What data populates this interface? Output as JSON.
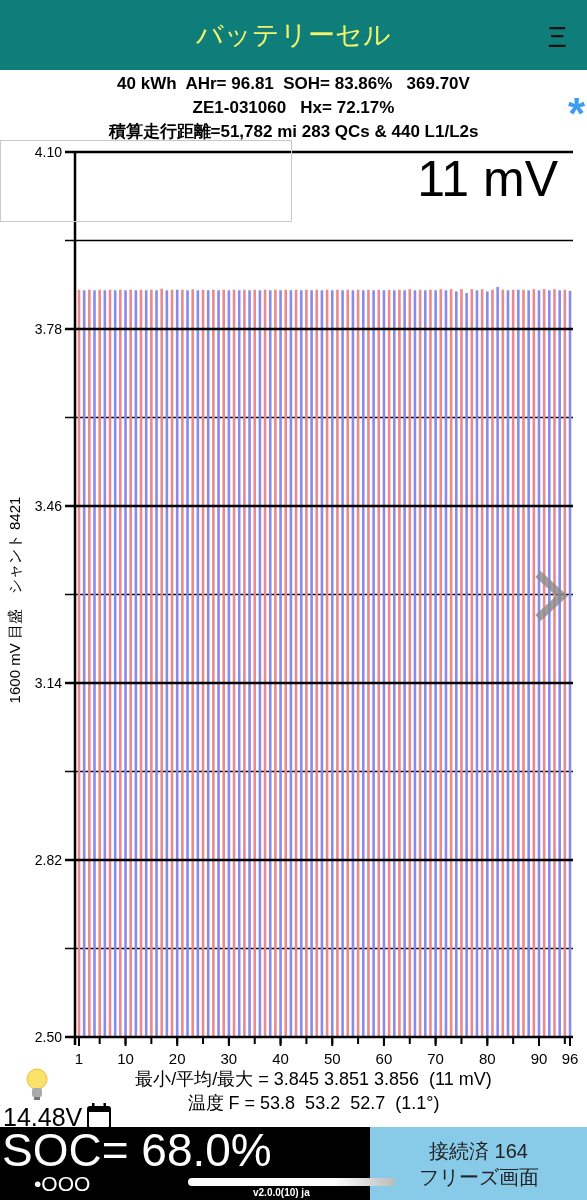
{
  "header": {
    "title": "バッテリーセル",
    "menu": "Ξ"
  },
  "info": {
    "lines": [
      "40 kWh  AHr= 96.81  SOH= 83.86%   369.70V",
      "ZE1-031060   Hx= 72.17%",
      "積算走行距離=51,782 mi 283 QCs & 440 L1/L2s"
    ],
    "asterisk": "*"
  },
  "cell_chart": {
    "chart_data": {
      "type": "bar",
      "ylabel": "1600 mV 目盛　シャント 8421",
      "ylim": [
        2.5,
        4.1
      ],
      "yticks": [
        {
          "value": 2.5,
          "label": "2.50"
        },
        {
          "value": 2.82,
          "label": "2.82"
        },
        {
          "value": 3.14,
          "label": "3.14"
        },
        {
          "value": 3.46,
          "label": "3.46"
        },
        {
          "value": 3.78,
          "label": "3.78"
        },
        {
          "value": 4.1,
          "label": "4.10"
        }
      ],
      "x": [
        1,
        2,
        3,
        4,
        5,
        6,
        7,
        8,
        9,
        10,
        11,
        12,
        13,
        14,
        15,
        16,
        17,
        18,
        19,
        20,
        21,
        22,
        23,
        24,
        25,
        26,
        27,
        28,
        29,
        30,
        31,
        32,
        33,
        34,
        35,
        36,
        37,
        38,
        39,
        40,
        41,
        42,
        43,
        44,
        45,
        46,
        47,
        48,
        49,
        50,
        51,
        52,
        53,
        54,
        55,
        56,
        57,
        58,
        59,
        60,
        61,
        62,
        63,
        64,
        65,
        66,
        67,
        68,
        69,
        70,
        71,
        72,
        73,
        74,
        75,
        76,
        77,
        78,
        79,
        80,
        81,
        82,
        83,
        84,
        85,
        86,
        87,
        88,
        89,
        90,
        91,
        92,
        93,
        94,
        95,
        96
      ],
      "xlim": [
        1,
        96
      ],
      "xticks": [
        1,
        10,
        20,
        30,
        40,
        50,
        60,
        70,
        80,
        90,
        96
      ],
      "grid": true,
      "annotations": [
        {
          "text": "11 mV"
        }
      ],
      "series": [
        {
          "color": "#e88a8f",
          "values": [
            3.851,
            null,
            3.851,
            null,
            3.851,
            null,
            3.851,
            null,
            3.851,
            null,
            3.851,
            null,
            3.851,
            null,
            3.851,
            null,
            3.853,
            null,
            3.851,
            null,
            3.851,
            null,
            3.852,
            null,
            3.851,
            null,
            3.851,
            null,
            3.851,
            null,
            3.851,
            null,
            3.851,
            null,
            3.851,
            null,
            3.851,
            null,
            3.851,
            null,
            3.851,
            null,
            3.851,
            null,
            3.851,
            null,
            3.851,
            null,
            3.851,
            null,
            3.851,
            null,
            3.851,
            null,
            3.851,
            null,
            3.851,
            null,
            3.851,
            null,
            3.851,
            null,
            3.851,
            null,
            3.852,
            null,
            3.851,
            null,
            3.851,
            null,
            3.852,
            null,
            3.852,
            null,
            3.852,
            null,
            3.852,
            null,
            3.852,
            null,
            3.851,
            null,
            3.851,
            null,
            3.851,
            null,
            3.851,
            null,
            3.852,
            null,
            3.852,
            null,
            3.852,
            null,
            3.851,
            null
          ]
        },
        {
          "color": "#8a8ae8",
          "values": [
            null,
            3.85,
            null,
            3.85,
            null,
            3.85,
            null,
            3.85,
            null,
            3.85,
            null,
            3.85,
            null,
            3.85,
            null,
            3.85,
            null,
            3.85,
            null,
            3.851,
            null,
            3.85,
            null,
            3.85,
            null,
            3.85,
            null,
            3.85,
            null,
            3.85,
            null,
            3.85,
            null,
            3.85,
            null,
            3.85,
            null,
            3.85,
            null,
            3.85,
            null,
            3.85,
            null,
            3.85,
            null,
            3.85,
            null,
            3.85,
            null,
            3.85,
            null,
            3.85,
            null,
            3.85,
            null,
            3.85,
            null,
            3.85,
            null,
            3.85,
            null,
            3.85,
            null,
            3.85,
            null,
            3.85,
            null,
            3.85,
            null,
            3.85,
            null,
            3.85,
            null,
            3.848,
            null,
            3.845,
            null,
            3.85,
            null,
            3.848,
            null,
            3.856,
            null,
            3.85,
            null,
            3.851,
            null,
            3.85,
            null,
            3.85,
            null,
            3.85,
            null,
            3.85,
            null,
            3.849
          ]
        }
      ]
    }
  },
  "stats": {
    "lines": [
      "最小/平均/最大 = 3.845 3.851 3.856  (11 mV)",
      "温度 F = 53.8  53.2  52.7  (1.1°)"
    ],
    "voltage": "14.48V"
  },
  "footer": {
    "soc": "SOC= 68.0%",
    "page_dots": "•OOO",
    "version": "v2.0.0(10) ja",
    "status_lines": [
      "接続済 164",
      "フリーズ画面"
    ]
  }
}
